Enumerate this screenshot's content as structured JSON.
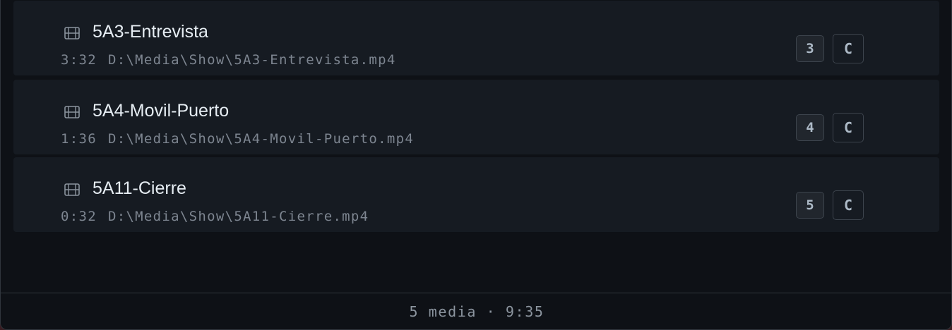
{
  "media_items": [
    {
      "name": "5A3-Entrevista",
      "duration": "3:32",
      "path": "D:\\Media\\Show\\5A3-Entrevista.mp4",
      "key": "3",
      "action_label": "C"
    },
    {
      "name": "5A4-Movil-Puerto",
      "duration": "1:36",
      "path": "D:\\Media\\Show\\5A4-Movil-Puerto.mp4",
      "key": "4",
      "action_label": "C"
    },
    {
      "name": "5A11-Cierre",
      "duration": "0:32",
      "path": "D:\\Media\\Show\\5A11-Cierre.mp4",
      "key": "5",
      "action_label": "C"
    }
  ],
  "footer": {
    "summary": "5 media · 9:35"
  },
  "icons": {
    "row_icon": "film-icon"
  },
  "colors": {
    "background": "#0e1116",
    "row": "#161b22",
    "text": "#e6edf3",
    "muted": "#7d8590",
    "border": "#30363d"
  }
}
